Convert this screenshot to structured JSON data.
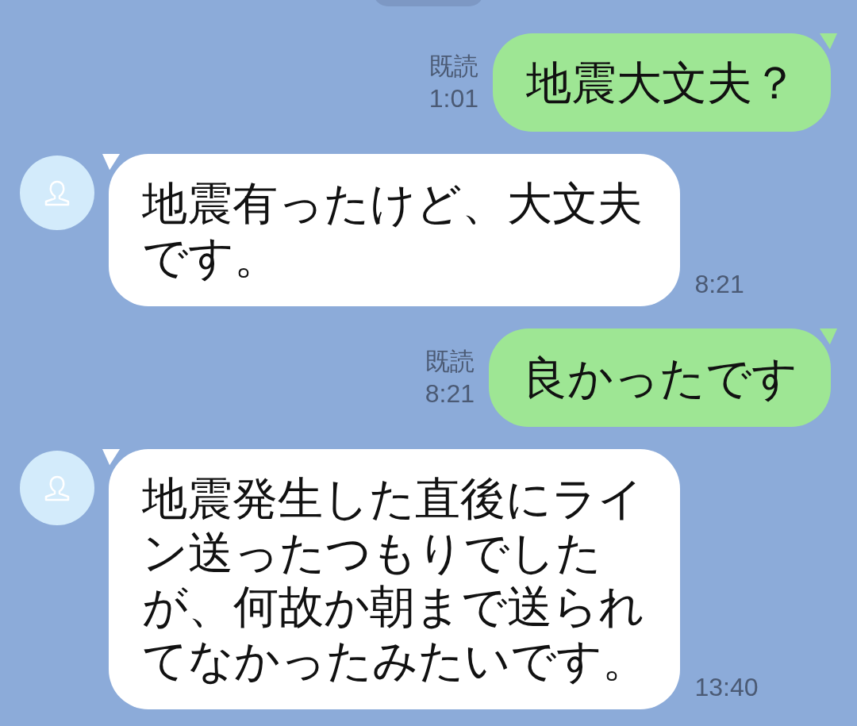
{
  "messages": [
    {
      "kind": "sent",
      "text": "地震大文夫？",
      "read_label": "既読",
      "time": "1:01"
    },
    {
      "kind": "received",
      "text": "地震有ったけど、大文夫です。",
      "time": "8:21"
    },
    {
      "kind": "sent",
      "text": "良かったです",
      "read_label": "既読",
      "time": "8:21"
    },
    {
      "kind": "received",
      "text": "地震発生した直後にライン送ったつもりでしたが、何故か朝まで送られてなかったみたいです。",
      "time": "13:40"
    }
  ]
}
